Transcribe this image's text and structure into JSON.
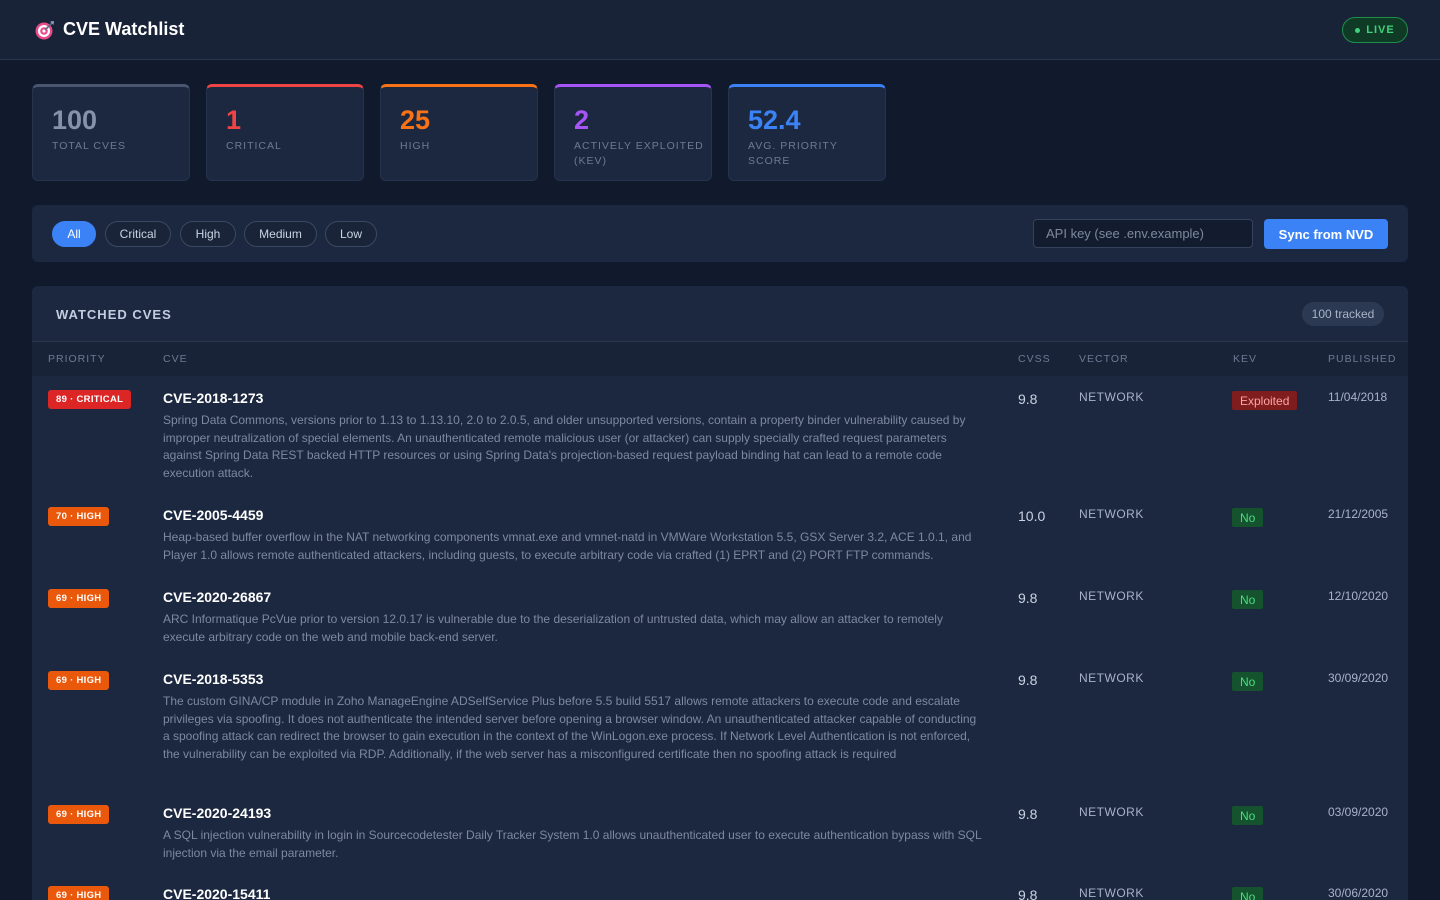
{
  "header": {
    "title": "CVE Watchlist",
    "logo_icon": "target-icon",
    "live_label": "LIVE"
  },
  "stats": [
    {
      "value": "100",
      "label": "TOTAL CVES",
      "color": "#8592a8",
      "accent": "#4a5670"
    },
    {
      "value": "1",
      "label": "CRITICAL",
      "color": "#ef4444",
      "accent": "#ef4444"
    },
    {
      "value": "25",
      "label": "HIGH",
      "color": "#f97316",
      "accent": "#f97316"
    },
    {
      "value": "2",
      "label": "ACTIVELY EXPLOITED (KEV)",
      "color": "#a855f7",
      "accent": "#a855f7"
    },
    {
      "value": "52.4",
      "label": "AVG. PRIORITY SCORE",
      "color": "#3b82f6",
      "accent": "#3b82f6"
    }
  ],
  "filters": {
    "options": [
      "All",
      "Critical",
      "High",
      "Medium",
      "Low"
    ],
    "selected": "All",
    "api_placeholder": "API key (see .env.example)",
    "sync_label": "Sync from NVD"
  },
  "table": {
    "title": "WATCHED CVES",
    "tracked_label": "100 tracked",
    "columns": [
      "PRIORITY",
      "CVE",
      "CVSS",
      "VECTOR",
      "KEV",
      "PUBLISHED"
    ],
    "rows": [
      {
        "priority": "89 · CRITICAL",
        "severity": "critical",
        "id": "CVE-2018-1273",
        "description": "Spring Data Commons, versions prior to 1.13 to 1.13.10, 2.0 to 2.0.5, and older unsupported versions, contain a property binder vulnerability caused by improper neutralization of special elements. An unauthenticated remote malicious user (or attacker) can supply specially crafted request parameters against Spring Data REST backed HTTP resources or using Spring Data's projection-based request payload binding hat can lead to a remote code execution attack.",
        "cvss": "9.8",
        "vector": "NETWORK",
        "kev": "Exploited",
        "kev_status": "exploited",
        "published": "11/04/2018"
      },
      {
        "priority": "70 · HIGH",
        "severity": "high",
        "id": "CVE-2005-4459",
        "description": "Heap-based buffer overflow in the NAT networking components vmnat.exe and vmnet-natd in VMWare Workstation 5.5, GSX Server 3.2, ACE 1.0.1, and Player 1.0 allows remote authenticated attackers, including guests, to execute arbitrary code via crafted (1) EPRT and (2) PORT FTP commands.",
        "cvss": "10.0",
        "vector": "NETWORK",
        "kev": "No",
        "kev_status": "no",
        "published": "21/12/2005"
      },
      {
        "priority": "69 · HIGH",
        "severity": "high",
        "id": "CVE-2020-26867",
        "description": "ARC Informatique PcVue prior to version 12.0.17 is vulnerable due to the deserialization of untrusted data, which may allow an attacker to remotely execute arbitrary code on the web and mobile back-end server.",
        "cvss": "9.8",
        "vector": "NETWORK",
        "kev": "No",
        "kev_status": "no",
        "published": "12/10/2020"
      },
      {
        "priority": "69 · HIGH",
        "severity": "high",
        "id": "CVE-2018-5353",
        "description": "The custom GINA/CP module in Zoho ManageEngine ADSelfService Plus before 5.5 build 5517 allows remote attackers to execute code and escalate privileges via spoofing. It does not authenticate the intended server before opening a browser window. An unauthenticated attacker capable of conducting a spoofing attack can redirect the browser to gain execution in the context of the WinLogon.exe process. If Network Level Authentication is not enforced, the vulnerability can be exploited via RDP. Additionally, if the web server has a misconfigured certificate then no spoofing attack is required",
        "cvss": "9.8",
        "vector": "NETWORK",
        "kev": "No",
        "kev_status": "no",
        "published": "30/09/2020"
      },
      {
        "priority": "69 · HIGH",
        "severity": "high",
        "id": "CVE-2020-24193",
        "description": "A SQL injection vulnerability in login in Sourcecodetester Daily Tracker System 1.0 allows unauthenticated user to execute authentication bypass with SQL injection via the email parameter.",
        "cvss": "9.8",
        "vector": "NETWORK",
        "kev": "No",
        "kev_status": "no",
        "published": "03/09/2020"
      },
      {
        "priority": "69 · HIGH",
        "severity": "high",
        "id": "CVE-2020-15411",
        "description": "",
        "cvss": "9.8",
        "vector": "NETWORK",
        "kev": "No",
        "kev_status": "no",
        "published": "30/06/2020"
      }
    ]
  }
}
